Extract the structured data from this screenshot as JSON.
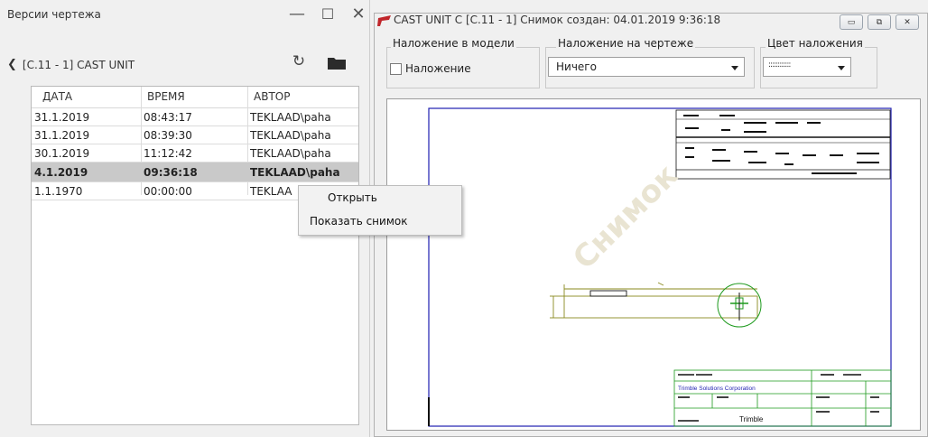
{
  "left_panel": {
    "title": "Версии чертежа",
    "window_buttons": [
      "—",
      "☐",
      "✕"
    ],
    "breadcrumb": "[C.11 - 1] CAST UNIT",
    "columns": [
      "ДАТА",
      "ВРЕМЯ",
      "АВТОР"
    ],
    "rows": [
      {
        "date": "31.1.2019",
        "time": "08:43:17",
        "author": "TEKLAAD\\paha"
      },
      {
        "date": "31.1.2019",
        "time": "08:39:30",
        "author": "TEKLAAD\\paha"
      },
      {
        "date": "30.1.2019",
        "time": "11:12:42",
        "author": "TEKLAAD\\paha"
      },
      {
        "date": "4.1.2019",
        "time": "09:36:18",
        "author": "TEKLAAD\\paha"
      },
      {
        "date": "1.1.1970",
        "time": "00:00:00",
        "author": "TEKLAA"
      }
    ],
    "selected_row": 3
  },
  "context_menu": {
    "items": [
      "Открыть",
      "Показать снимок"
    ]
  },
  "right_window": {
    "title": "CAST UNIT C  [C.11 - 1]  Снимок создан: 04.01.2019 9:36:18",
    "mdi_buttons": [
      "▭",
      "⧉",
      "✕"
    ],
    "group_model": {
      "label": "Наложение в модели",
      "checkbox_label": "Наложение",
      "checked": false
    },
    "group_drawing": {
      "label": "Наложение на чертеже",
      "value": "Ничего"
    },
    "group_color": {
      "label": "Цвет наложения",
      "value": "::::::::::::"
    },
    "watermark": "Снимок",
    "title_block": {
      "company": "Trimble Solutions Corporation",
      "brand": "Trimble"
    }
  },
  "colors": {
    "selected_row": "#c9c9c9",
    "drawing_border": "#1f1fb0",
    "dim_line": "#8a8a1e",
    "detail_circle": "#1d9a1d",
    "app_icon": "#c0262b"
  }
}
